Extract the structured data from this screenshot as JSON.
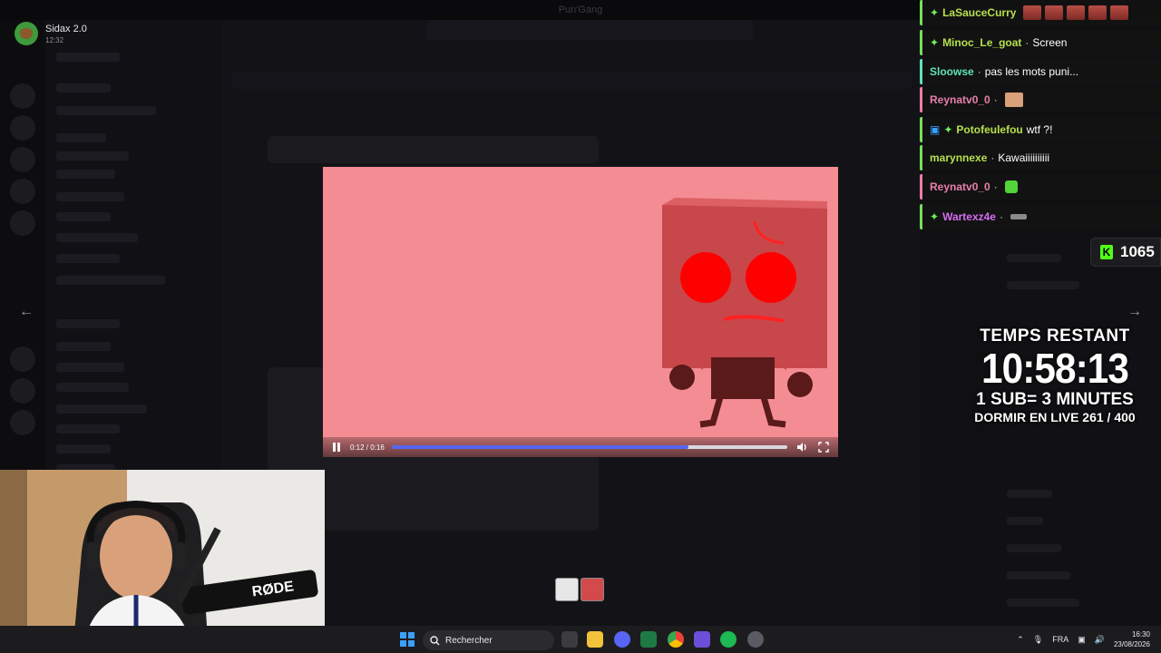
{
  "window": {
    "title": "Pun'Gang"
  },
  "user": {
    "name": "Sidax 2.0",
    "time": "12:32"
  },
  "player": {
    "current_time": "0:12",
    "duration": "0:16",
    "time_label": "0:12 / 0:16",
    "progress_fraction": 0.75,
    "colors": {
      "background": "#f48d93",
      "progress": "#5865f2"
    }
  },
  "chat": {
    "messages": [
      {
        "user": "LaSauceCurry",
        "color": "#74e05e",
        "message": "",
        "badge": "spark",
        "emote": "characters"
      },
      {
        "user": "Minoc_Le_goat",
        "color": "#b5e04b",
        "message": "Screen",
        "badge": "spark"
      },
      {
        "user": "Sloowse",
        "color": "#5fe3b4",
        "message": "pas les mots puni...",
        "badge": ""
      },
      {
        "user": "Reynatv0_0",
        "color": "#e87fa6",
        "message": "",
        "badge": "",
        "emote": "hand"
      },
      {
        "user": "Potofeulefou",
        "color": "#b5e04b",
        "message": "wtf ?!",
        "badge": "cube-spark"
      },
      {
        "user": "marynnexe",
        "color": "#74e05e",
        "message": "Kawaiiiiiiiiii",
        "badge": ""
      },
      {
        "user": "Reynatv0_0",
        "color": "#e87fa6",
        "message": "",
        "badge": "",
        "emote": "green"
      },
      {
        "user": "Wartexz4e",
        "color": "#d46ef0",
        "message": "",
        "badge": "spark",
        "emote": "small"
      }
    ]
  },
  "kick": {
    "count": "1065"
  },
  "timer": {
    "label": "TEMPS RESTANT",
    "value": "10:58:13",
    "sub_rule": "1 SUB= 3 MINUTES",
    "sleep_progress": "DORMIR EN LIVE 261 / 400"
  },
  "webcam": {
    "mic_brand": "RØDE"
  },
  "taskbar": {
    "search_placeholder": "Rechercher",
    "language": "FRA",
    "time": "16:30",
    "date": "23/08/2026"
  },
  "icons": {
    "start": "windows-start-icon",
    "search": "search-icon",
    "files": "folder-icon",
    "discord": "discord-icon",
    "excel": "excel-icon",
    "chrome": "chrome-icon",
    "apps": "app-grid-icon",
    "spotify": "spotify-icon",
    "settings": "gear-icon"
  }
}
